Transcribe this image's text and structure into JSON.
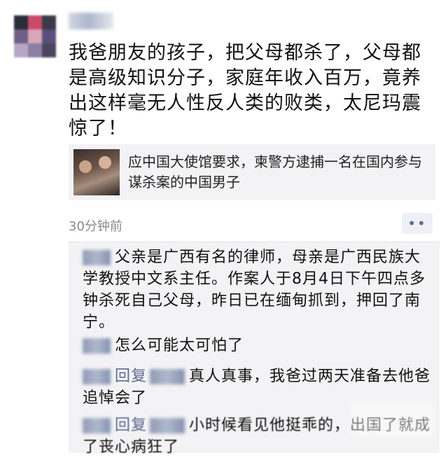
{
  "post": {
    "text": "我爸朋友的孩子，把父母都杀了，父母都是高级知识分子，家庭年收入百万，竟养出这样毫无人性反人类的败类，太尼玛震惊了！",
    "timestamp": "30分钟前",
    "more_label": "••"
  },
  "link_card": {
    "title": "应中国大使馆要求，柬警方逮捕一名在国内参与谋杀案的中国男子"
  },
  "comments": [
    {
      "text": "父亲是广西有名的律师，母亲是广西民族大学教授中文系主任。作案人于8月4日下午四点多钟杀死自己父母，昨日已在缅甸抓到，押回了南宁。"
    },
    {
      "text": "怎么可能太可怕了"
    },
    {
      "reply_word": "回复",
      "text": "真人真事，我爸过两天准备去他爸追悼会了"
    },
    {
      "reply_word": "回复",
      "text": "小时候看见他挺乖的，出国了就成了丧心病狂了"
    }
  ]
}
